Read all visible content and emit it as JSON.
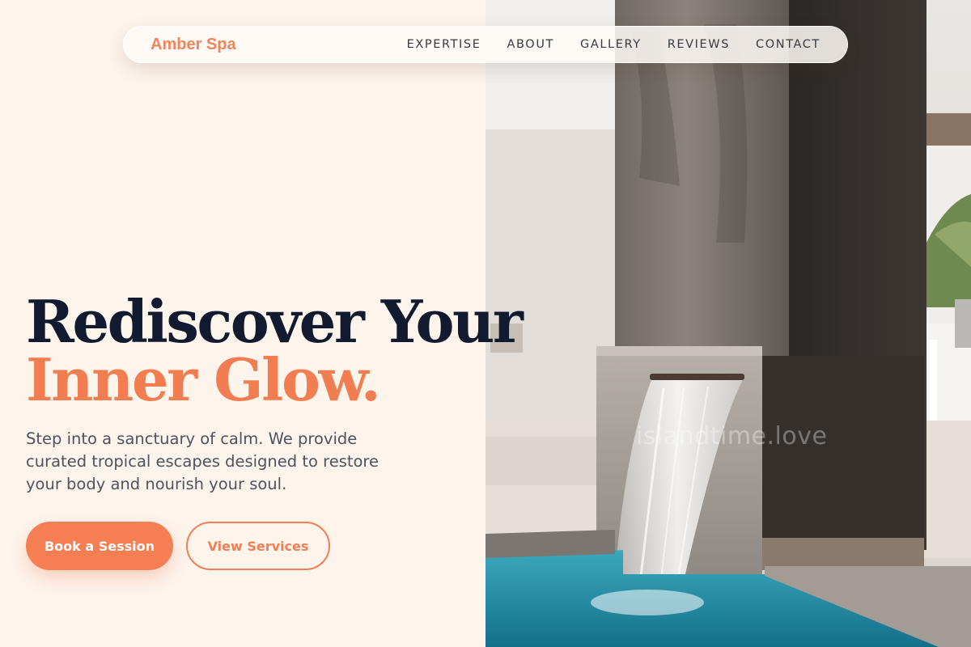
{
  "nav": {
    "brand": "Amber Spa",
    "links": [
      "EXPERTISE",
      "ABOUT",
      "GALLERY",
      "REVIEWS",
      "CONTACT"
    ]
  },
  "hero": {
    "title_line1": "Rediscover Your",
    "title_line2": "Inner Glow.",
    "description": "Step into a sanctuary of calm. We provide curated tropical escapes designed to restore your body and nourish your soul.",
    "primary_button": "Book a Session",
    "secondary_button": "View Services"
  },
  "photo": {
    "watermark": "islandtime.love"
  },
  "colors": {
    "accent": "#f57f52",
    "heading": "#111a2e",
    "background": "#fdf4ec",
    "body_text": "#4c5361"
  }
}
